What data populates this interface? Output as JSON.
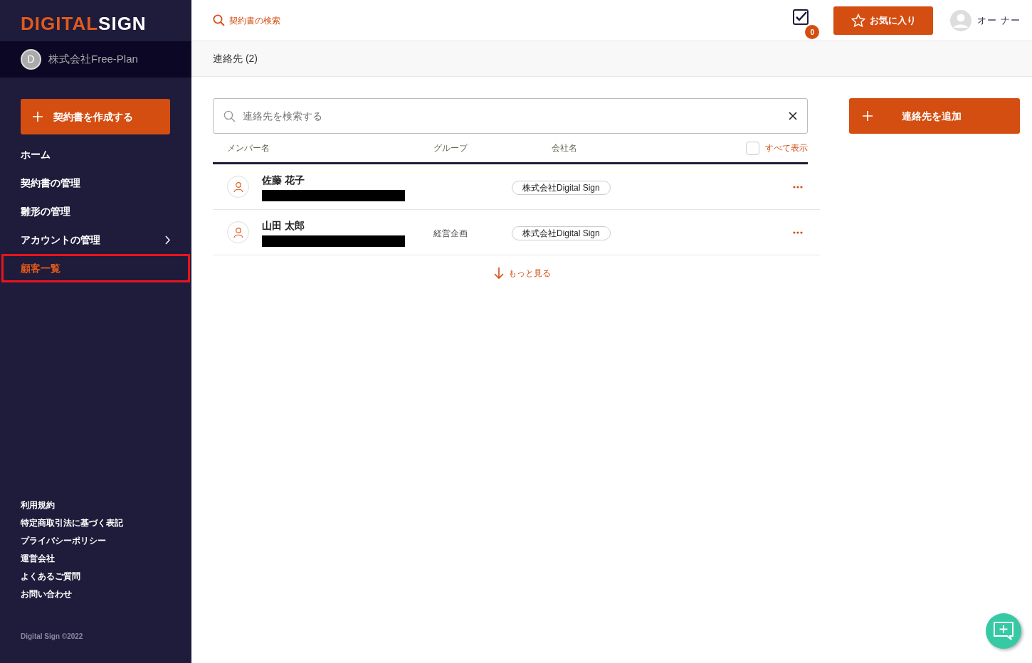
{
  "sidebar": {
    "logo": {
      "part_1": "DIGITAL",
      "part_2": "SIGN"
    },
    "company": {
      "avatar_letter": "D",
      "name": "株式会社Free-Plan"
    },
    "create_button": {
      "label": "契約書を作成する"
    },
    "items": [
      {
        "label": "ホーム",
        "has_submenu": false,
        "selected": false
      },
      {
        "label": "契約書の管理",
        "has_submenu": false,
        "selected": false
      },
      {
        "label": "雛形の管理",
        "has_submenu": false,
        "selected": false
      },
      {
        "label": "アカウントの管理",
        "has_submenu": true,
        "selected": false
      },
      {
        "label": "顧客一覧",
        "has_submenu": false,
        "selected": true
      }
    ],
    "footer_links": [
      "利用規約",
      "特定商取引法に基づく表記",
      "プライバシーポリシー",
      "運営会社",
      "よくあるご質問",
      "お問い合わせ"
    ],
    "copyright": "Digital Sign ©2022"
  },
  "header": {
    "search_link": "契約書の検索",
    "task_count": "0",
    "favorites_button": "お気に入り",
    "user_name": "オー ナー"
  },
  "breadcrumb": "連絡先 (2)",
  "search": {
    "placeholder": "連絡先を検索する"
  },
  "add_button": {
    "label": "連絡先を追加"
  },
  "table": {
    "columns": [
      "メンバー名",
      "グループ",
      "会社名"
    ],
    "show_all": {
      "label": "すべて表示",
      "checked": false
    },
    "rows": [
      {
        "name": "佐藤 花子",
        "group": "",
        "company": "株式会社Digital Sign"
      },
      {
        "name": "山田 太郎",
        "group": "経営企画",
        "company": "株式会社Digital Sign"
      }
    ]
  },
  "more_link": "もっと見る"
}
